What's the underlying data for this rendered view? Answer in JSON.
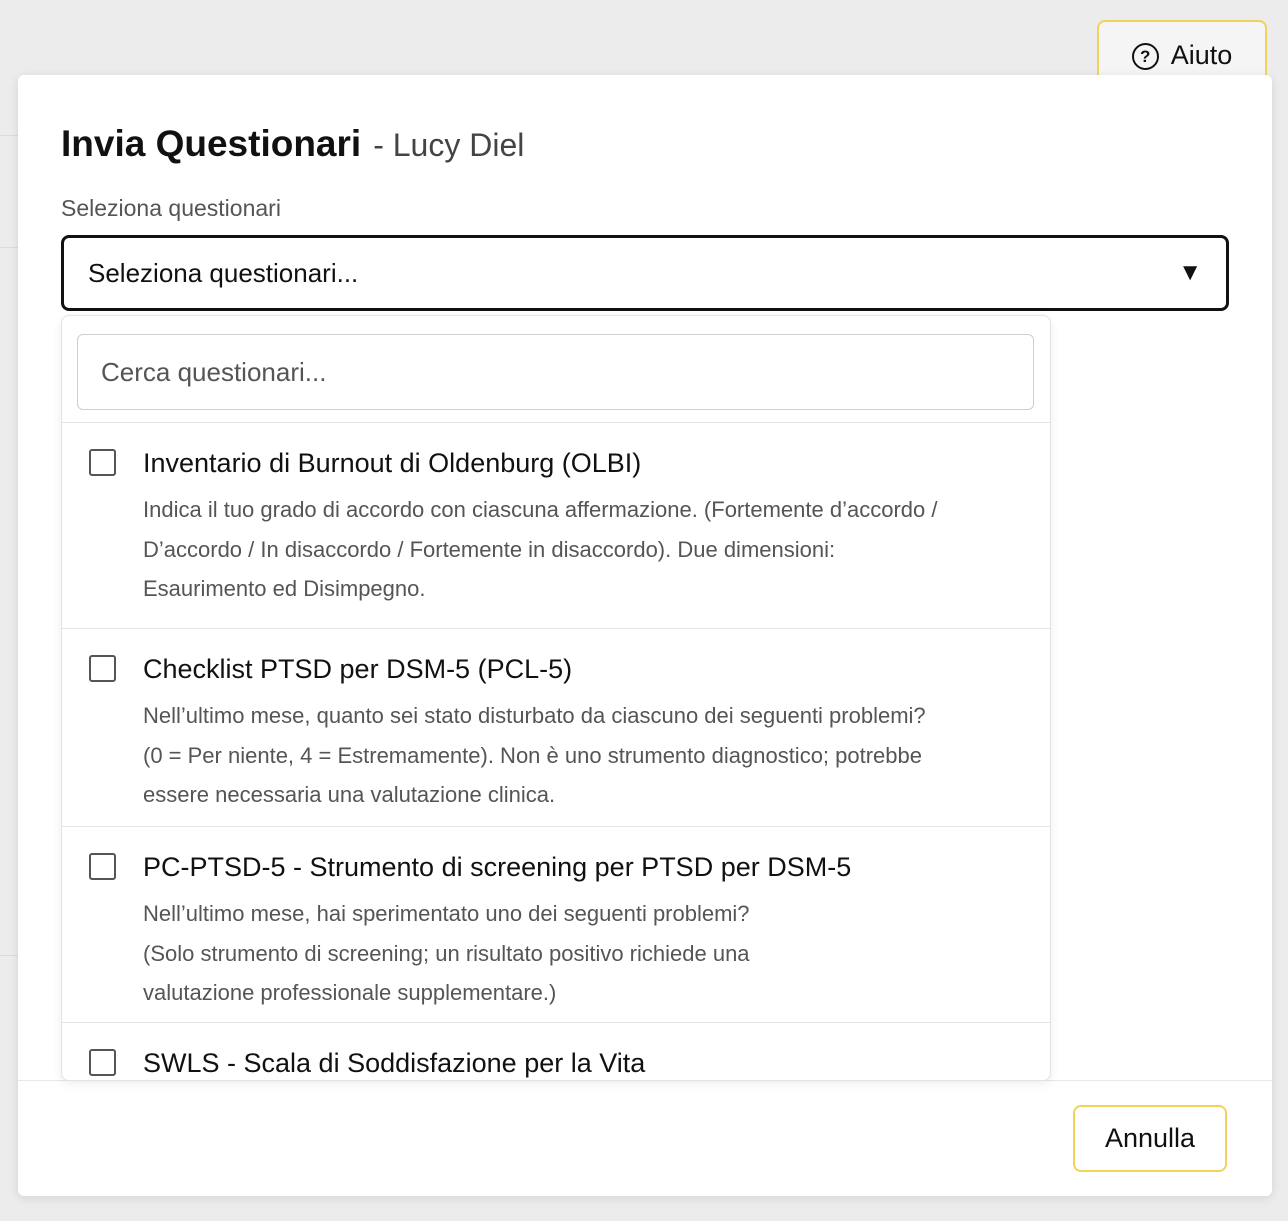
{
  "help_button": {
    "label": "Aiuto",
    "icon": "help-circle-icon"
  },
  "modal": {
    "title": "Invia Questionari",
    "subtitle": "- Lucy Diel",
    "select_label": "Seleziona questionari",
    "select_value": "Seleziona questionari...",
    "search_placeholder": "Cerca questionari...",
    "items": [
      {
        "title": "Inventario di Burnout di Oldenburg (OLBI)",
        "description": "Indica il tuo grado di accordo con ciascuna affermazione. (Fortemente d’accordo /\nD’accordo / In disaccordo / Fortemente in disaccordo).  Due dimensioni:\nEsaurimento ed Disimpegno."
      },
      {
        "title": "Checklist PTSD per DSM-5 (PCL-5)",
        "description": "Nell’ultimo mese, quanto sei stato disturbato da ciascuno dei seguenti problemi?\n(0 = Per niente, 4 = Estremamente).  Non è uno strumento diagnostico; potrebbe\nessere necessaria una valutazione clinica."
      },
      {
        "title": "PC-PTSD-5 - Strumento di screening per PTSD per DSM-5",
        "description": "Nell’ultimo mese, hai sperimentato uno dei seguenti problemi?\n(Solo strumento di screening; un risultato positivo richiede una\nvalutazione professionale supplementare.)"
      },
      {
        "title": "SWLS - Scala di Soddisfazione per la Vita",
        "description": ""
      }
    ],
    "cancel_label": "Annulla"
  },
  "colors": {
    "accent_border": "#f1d35c",
    "background": "#ececed"
  }
}
